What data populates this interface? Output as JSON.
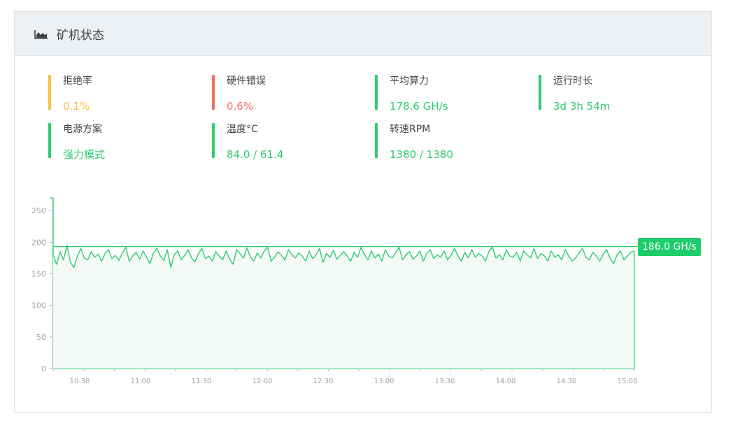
{
  "header": {
    "title": "矿机状态",
    "icon": "area-chart-icon"
  },
  "stats": [
    {
      "key": "reject-rate",
      "label": "拒绝率",
      "value": "0.1%",
      "color": "#f5c342"
    },
    {
      "key": "hardware-error",
      "label": "硬件错误",
      "value": "0.6%",
      "color": "#f06f6f"
    },
    {
      "key": "avg-hashrate",
      "label": "平均算力",
      "value": "178.6 GH/s",
      "color": "#2ecc71"
    },
    {
      "key": "uptime",
      "label": "运行时长",
      "value": "3d 3h 54m",
      "color": "#2ecc71"
    },
    {
      "key": "power-mode",
      "label": "电源方案",
      "value": "强力模式",
      "color": "#2ecc71"
    },
    {
      "key": "temperature",
      "label": "温度°C",
      "value": "84.0 / 61.4",
      "color": "#2ecc71"
    },
    {
      "key": "fan-speed",
      "label": "转速RPM",
      "value": "1380 / 1380",
      "color": "#2ecc71"
    }
  ],
  "colors": {
    "line": "#2ecc71",
    "fill": "#f4f9f6",
    "badge": "#1ccd6a"
  },
  "chart_data": {
    "type": "line",
    "title": "",
    "xlabel": "",
    "ylabel": "",
    "ylim": [
      0,
      270
    ],
    "yticks": [
      0,
      50,
      100,
      150,
      200,
      250
    ],
    "x_tick_labels": [
      "10:30",
      "11:00",
      "11:30",
      "12:00",
      "12:30",
      "13:00",
      "13:30",
      "14:00",
      "14:30",
      "15:00"
    ],
    "reference_line": 193,
    "current_label": "186.0 GH/s",
    "series": [
      {
        "values": [
          180,
          165,
          185,
          172,
          195,
          168,
          160,
          178,
          190,
          175,
          172,
          185,
          176,
          181,
          170,
          182,
          188,
          174,
          179,
          171,
          183,
          192,
          170,
          178,
          184,
          173,
          186,
          176,
          166,
          183,
          190,
          178,
          171,
          188,
          160,
          180,
          186,
          172,
          179,
          188,
          175,
          169,
          182,
          190,
          174,
          178,
          170,
          185,
          178,
          172,
          186,
          173,
          165,
          188,
          182,
          175,
          191,
          177,
          170,
          183,
          175,
          186,
          192,
          170,
          176,
          185,
          179,
          172,
          188,
          180,
          175,
          183,
          178,
          170,
          186,
          174,
          180,
          190,
          168,
          182,
          176,
          187,
          173,
          179,
          185,
          178,
          170,
          184,
          176,
          192,
          180,
          172,
          186,
          175,
          181,
          170,
          188,
          178,
          175,
          183,
          192,
          172,
          180,
          185,
          173,
          178,
          186,
          170,
          182,
          188,
          174,
          180,
          176,
          186,
          172,
          179,
          190,
          178,
          170,
          184,
          175,
          188,
          176,
          182,
          178,
          170,
          186,
          192,
          175,
          180,
          172,
          188,
          178,
          176,
          184,
          170,
          186,
          180,
          175,
          190,
          174,
          182,
          178,
          170,
          186,
          176,
          180,
          172,
          188,
          178,
          170,
          175,
          183,
          190,
          176,
          172,
          184,
          178,
          170,
          181,
          188,
          174,
          166,
          180,
          186,
          172,
          178,
          184,
          186
        ]
      }
    ]
  }
}
